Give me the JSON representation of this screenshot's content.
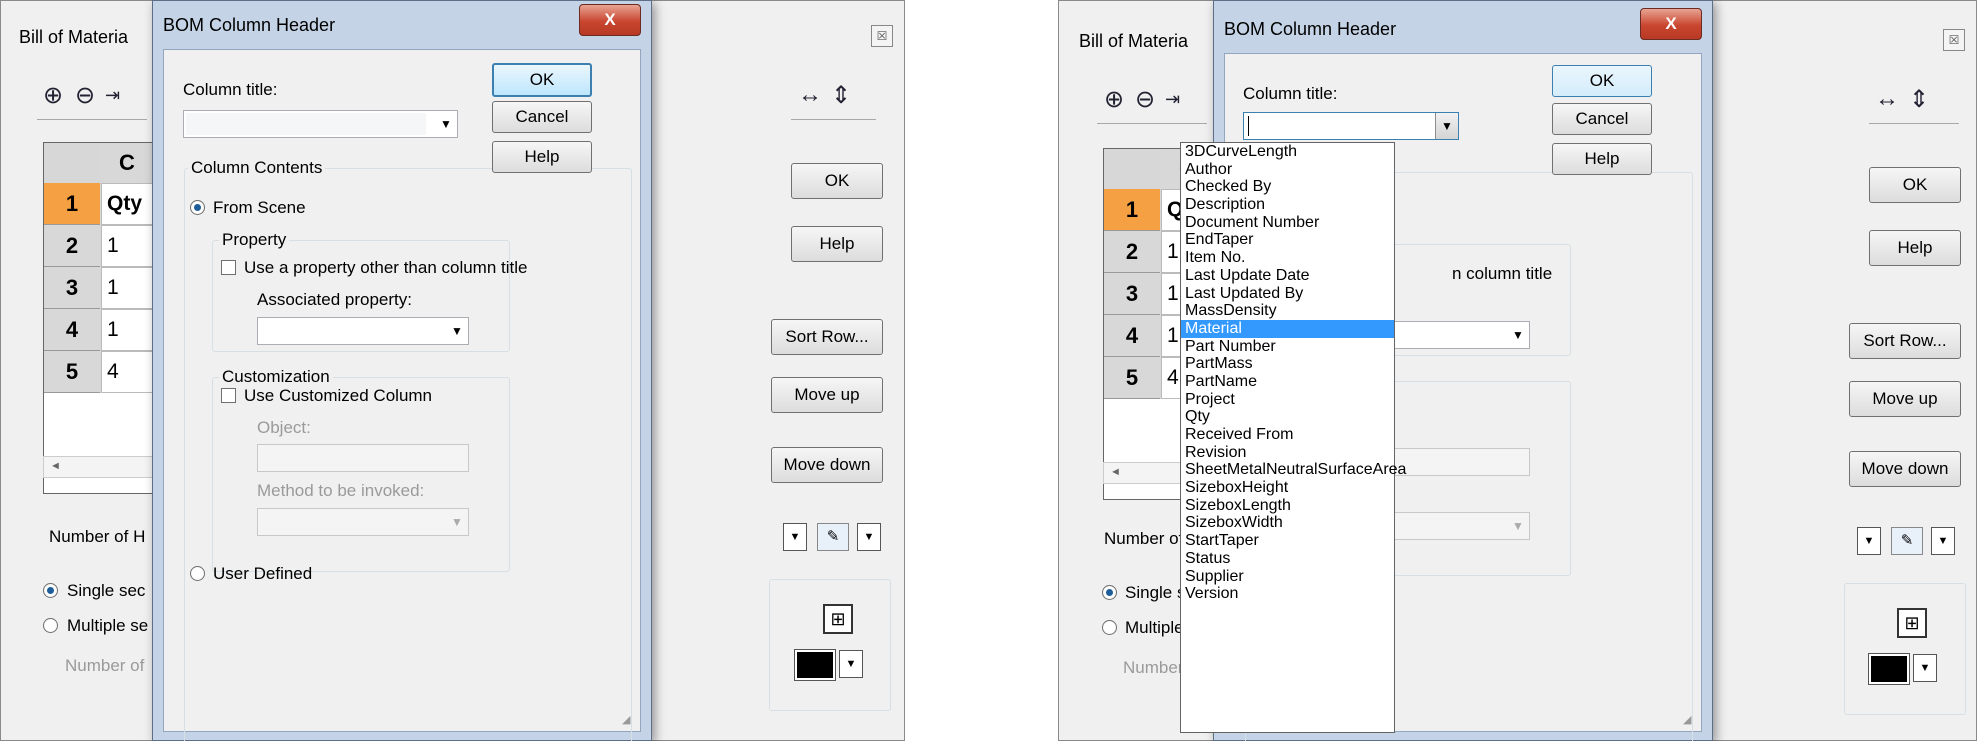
{
  "bom": {
    "title": "Bill of Materia",
    "close": "☒",
    "toolbar": [
      "⊕",
      "⊖",
      "⇥",
      "↔",
      "⇕"
    ],
    "col_header": "C",
    "rows": [
      {
        "num": "1",
        "val": "Qty"
      },
      {
        "num": "2",
        "val": "1"
      },
      {
        "num": "3",
        "val": "1"
      },
      {
        "num": "4",
        "val": "1"
      },
      {
        "num": "5",
        "val": "4"
      }
    ],
    "scroll_left": "◄",
    "ok": "OK",
    "help": "Help",
    "sort_row": "Sort Row...",
    "move_up": "Move up",
    "move_down": "Move down",
    "number_of_h": "Number of H",
    "single": "Single sec",
    "multiple": "Multiple se",
    "number_of": "Number of",
    "dropdown_arrow": "▼",
    "fill_icon": "✎",
    "layout_icon": "⊞"
  },
  "dialog": {
    "title": "BOM Column Header",
    "close": "X",
    "column_title_label": "Column title:",
    "column_title_value": "",
    "ok": "OK",
    "cancel": "Cancel",
    "help": "Help",
    "column_contents": "Column Contents",
    "from_scene": "From Scene",
    "property_group": "Property",
    "use_property": "Use a property other than column title",
    "associated_property": "Associated property:",
    "customization": "Customization",
    "use_customized": "Use Customized Column",
    "object_label": "Object:",
    "method_label": "Method to be invoked:",
    "user_defined": "User Defined",
    "arrow": "▼"
  },
  "partial_texts": {
    "n_column_title": "n column title"
  },
  "dropdown_items": [
    "3DCurveLength",
    "Author",
    "Checked By",
    "Description",
    "Document Number",
    "EndTaper",
    "Item No.",
    "Last Update Date",
    "Last Updated By",
    "MassDensity",
    "Material",
    "Part Number",
    "PartMass",
    "PartName",
    "Project",
    "Qty",
    "Received From",
    "Revision",
    "SheetMetalNeutralSurfaceArea",
    "SizeboxHeight",
    "SizeboxLength",
    "SizeboxWidth",
    "StartTaper",
    "Status",
    "Supplier",
    "Version"
  ],
  "dropdown_selected": "Material"
}
